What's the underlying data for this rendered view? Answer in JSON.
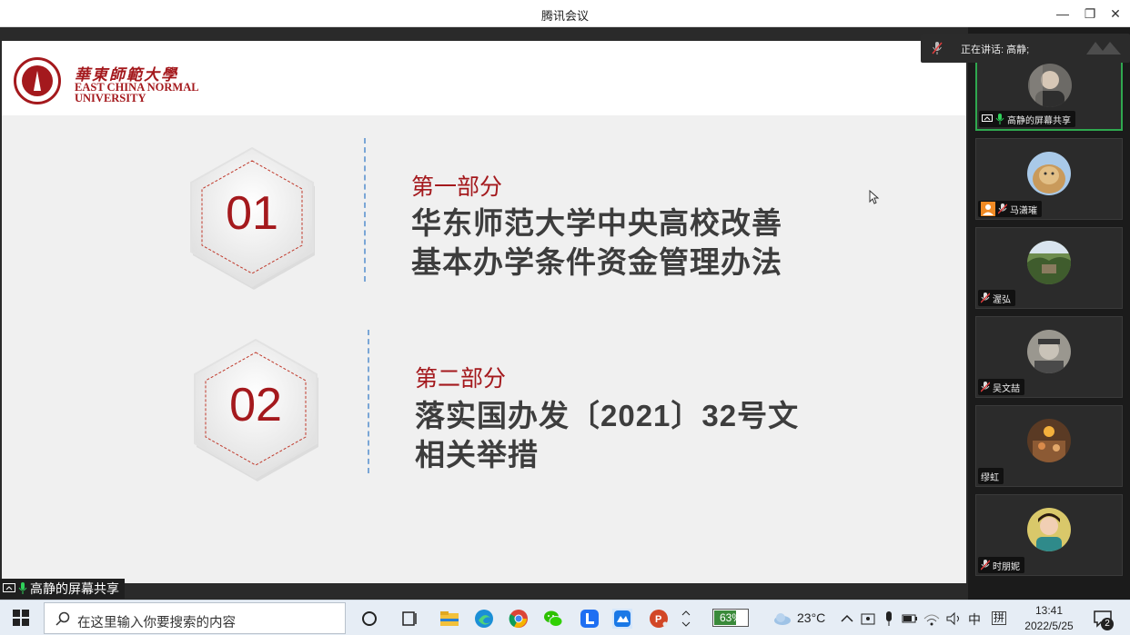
{
  "window": {
    "title": "腾讯会议",
    "controls": [
      "minimize",
      "restore",
      "close"
    ]
  },
  "slide": {
    "logo": {
      "cn": "華東師範大學",
      "en_line1": "EAST CHINA NORMAL",
      "en_line2": "UNIVERSITY"
    },
    "sections": [
      {
        "number": "01",
        "label": "第一部分",
        "title_line1": "华东师范大学中央高校改善",
        "title_line2": "基本办学条件资金管理办法"
      },
      {
        "number": "02",
        "label": "第二部分",
        "title_line1": "落实国办发〔2021〕32号文",
        "title_line2": "相关举措"
      }
    ],
    "colors": {
      "accent": "#a4191d",
      "title": "#3d3d3d",
      "divider": "#7aa6d6",
      "background": "#f0f0f0"
    }
  },
  "speaking_banner": {
    "text": "正在讲话: 高静;"
  },
  "participants": [
    {
      "name": "高静的屏幕共享",
      "sharing": true,
      "mic": "on"
    },
    {
      "name": "马潇璀",
      "mic": "muted",
      "has_contact_icon": true
    },
    {
      "name": "渥弘",
      "mic": "muted"
    },
    {
      "name": "吴文喆",
      "mic": "muted"
    },
    {
      "name": "缪虹",
      "mic": "none"
    },
    {
      "name": "时朋妮",
      "mic": "muted"
    }
  ],
  "share_label": "高静的屏幕共享",
  "taskbar": {
    "search_placeholder": "在这里输入你要搜索的内容",
    "battery_percent": "63%",
    "weather": "23°C",
    "ime": "中",
    "ime_mode": "拼",
    "time": "13:41",
    "date": "2022/5/25",
    "notifications": "2",
    "pinned_apps": [
      "task-view-icon",
      "file-explorer-icon",
      "edge-icon",
      "chrome-icon",
      "wechat-icon",
      "lark-icon",
      "tencent-meeting-icon",
      "powerpoint-icon"
    ]
  }
}
